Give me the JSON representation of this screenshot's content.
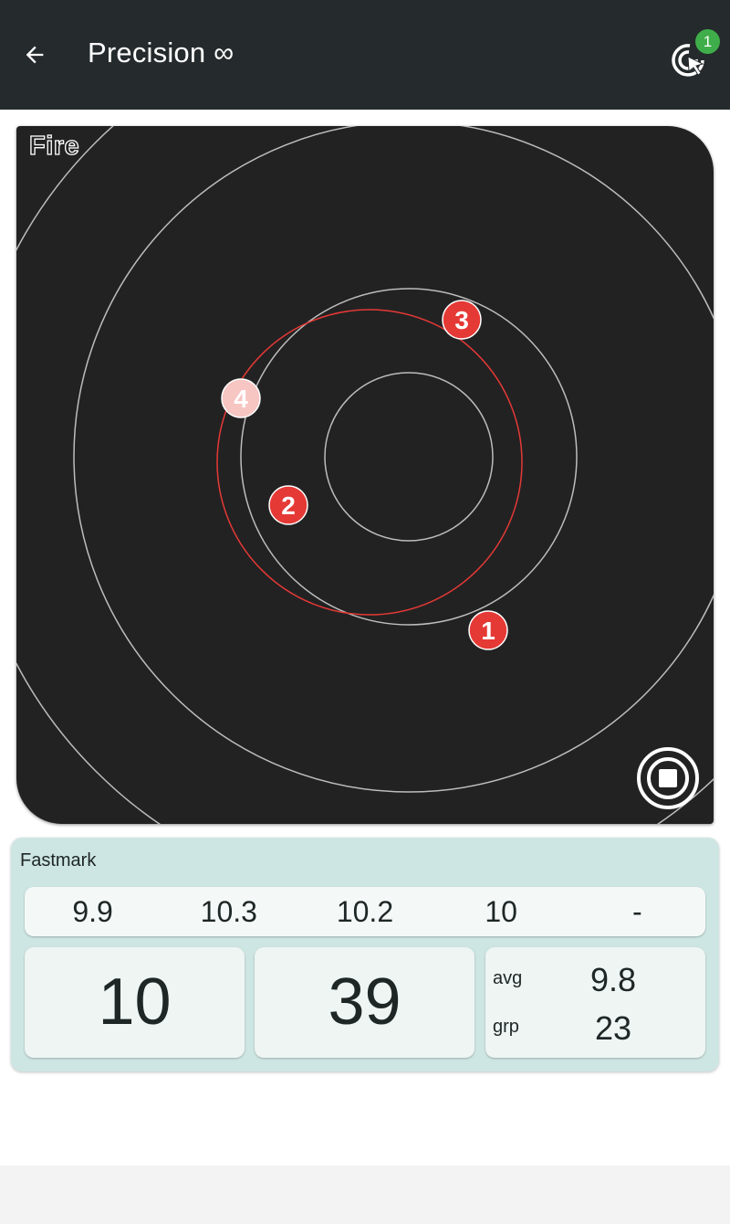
{
  "header": {
    "title": "Precision ∞",
    "back_icon": "arrow-left-icon",
    "target_icon": "target-cursor-icon",
    "badge_count": "1",
    "badge_color": "#3fae4a",
    "background_color": "#252b2c"
  },
  "target": {
    "mode_label": "Fire",
    "shots": [
      {
        "label": "1",
        "color": "#e53935",
        "faded": false
      },
      {
        "label": "2",
        "color": "#e53935",
        "faded": false
      },
      {
        "label": "3",
        "color": "#e53935",
        "faded": false
      },
      {
        "label": "4",
        "color": "#f7c5c2",
        "faded": true
      }
    ],
    "group_circle_color": "#e53935",
    "stop_icon": "stop-icon"
  },
  "scores": {
    "title": "Fastmark",
    "shot_values": [
      "9.9",
      "10.3",
      "10.2",
      "10",
      "-"
    ],
    "last_score": "10",
    "total": "39",
    "avg_label": "avg",
    "avg_value": "9.8",
    "grp_label": "grp",
    "grp_value": "23",
    "panel_color": "#cee6e3"
  }
}
